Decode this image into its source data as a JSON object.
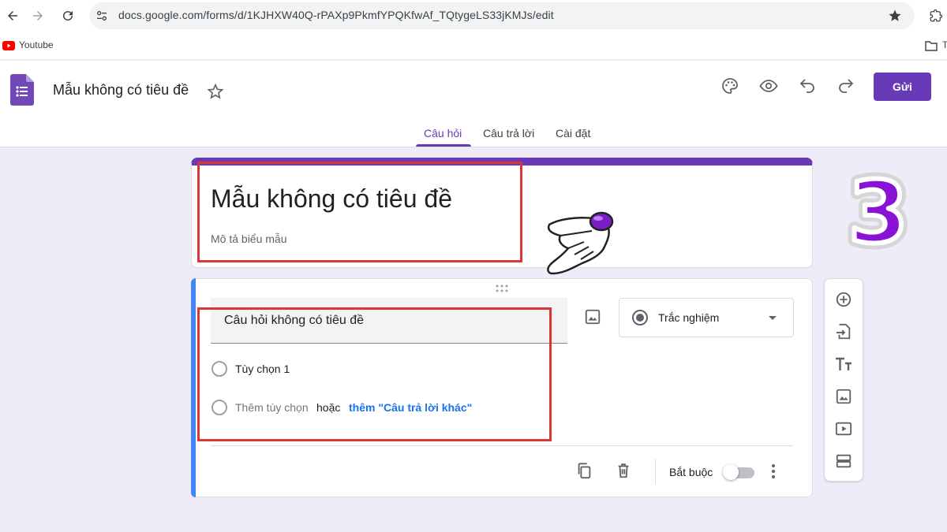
{
  "browser": {
    "url": "docs.google.com/forms/d/1KJHXW40Q-rPAXp9PkmfYPQKfwAf_TQtygeLS33jKMJs/edit",
    "bookmark": "Youtube",
    "bookmark_folder_label": "T"
  },
  "header": {
    "doc_title": "Mẫu không có tiêu đề",
    "send_label": "Gửi",
    "tabs": [
      {
        "label": "Câu hỏi",
        "active": true
      },
      {
        "label": "Câu trả lời",
        "active": false
      },
      {
        "label": "Cài đặt",
        "active": false
      }
    ]
  },
  "title_card": {
    "title": "Mẫu không có tiêu đề",
    "description": "Mô tả biểu mẫu"
  },
  "question": {
    "title": "Câu hỏi không có tiêu đề",
    "type": "Trắc nghiệm",
    "option_1": "Tùy chọn 1",
    "add_option": "Thêm tùy chọn",
    "or": "hoặc",
    "add_other": "thêm \"Câu trả lời khác\"",
    "required_label": "Bắt buộc",
    "required_on": false
  },
  "annotation": {
    "step_number": "3"
  },
  "colors": {
    "accent": "#673ab7",
    "page_bg": "#f0ebf8",
    "question_accent": "#4285f4",
    "link": "#1a73e8",
    "highlight": "#d93636"
  }
}
